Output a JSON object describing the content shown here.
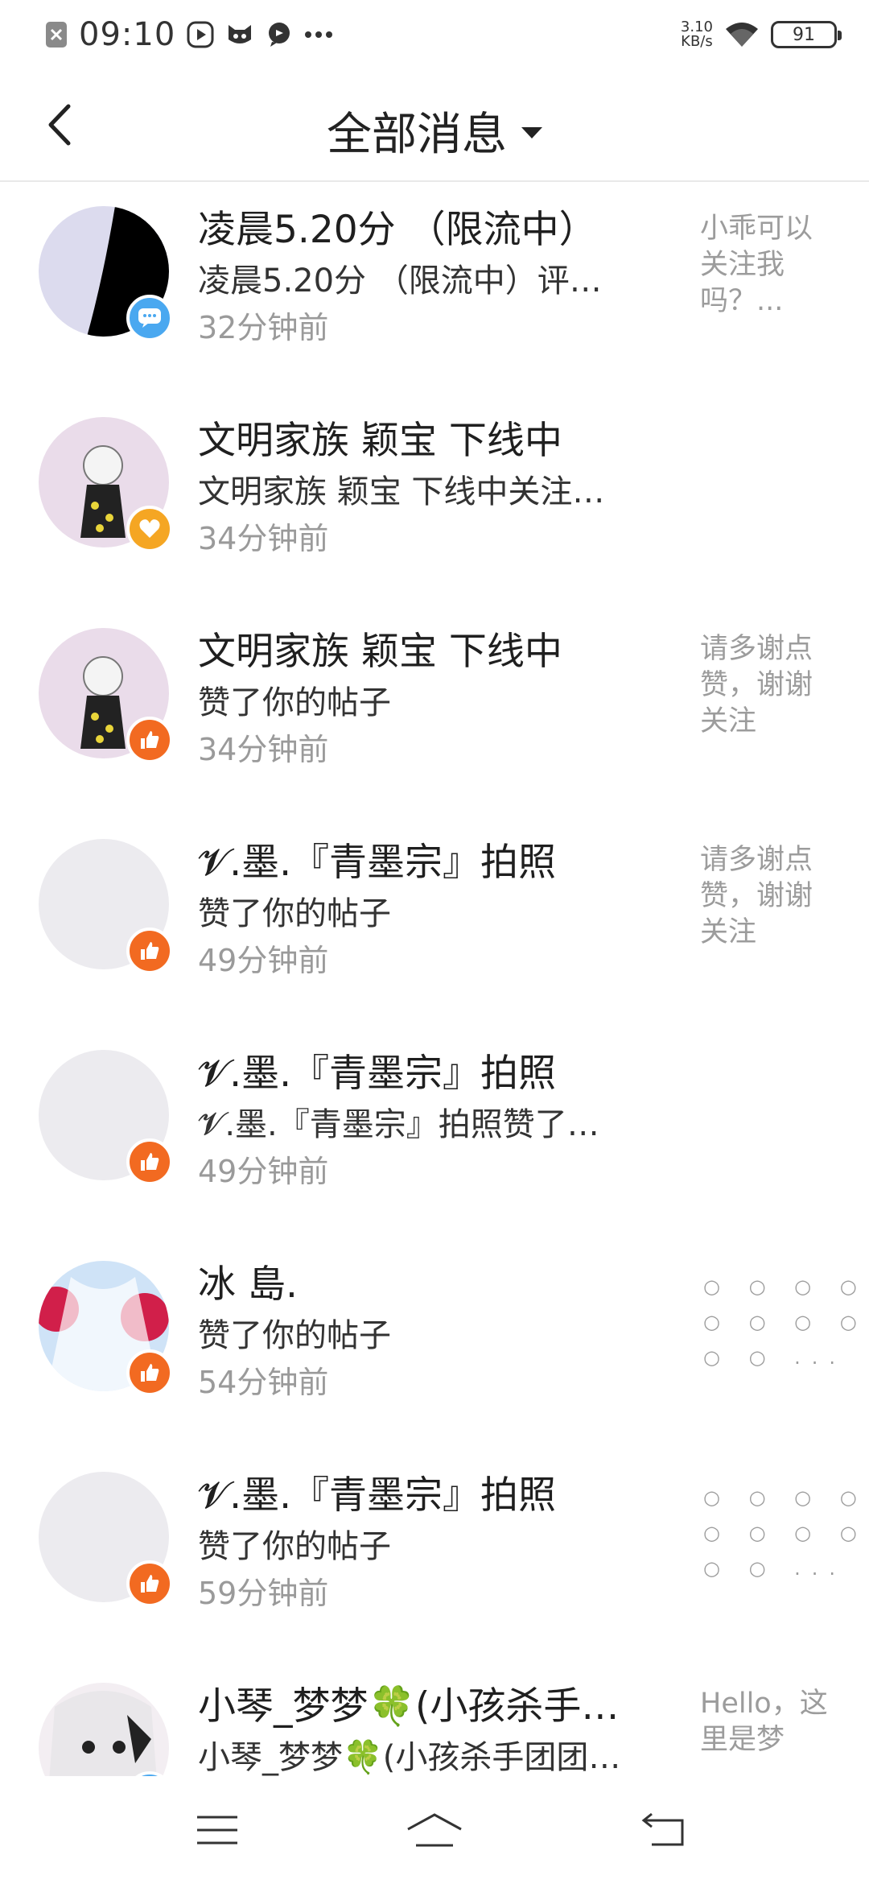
{
  "status_bar": {
    "time": "09:10",
    "net_speed_value": "3.10",
    "net_speed_unit": "KB/s",
    "battery": "91",
    "icons": [
      "close-box-icon",
      "play-circle-icon",
      "cat-app-icon",
      "chat-bubble-icon",
      "more-dots-icon",
      "wifi-icon",
      "battery-icon"
    ]
  },
  "header": {
    "title": "全部消息",
    "back_icon": "chevron-left-icon",
    "dropdown_icon": "caret-down-icon"
  },
  "messages": [
    {
      "name": "凌晨5.20分 （限流中）",
      "content": "凌晨5.20分 （限流中）评…",
      "time": "32分钟前",
      "right_text": "小乖可以关注我吗？...",
      "badge": "msg",
      "avatar_color": "#000000"
    },
    {
      "name": "文明家族  颖宝  下线中",
      "content": "文明家族  颖宝  下线中关注…",
      "time": "34分钟前",
      "right_text": "",
      "badge": "heart",
      "avatar_color": "#eadcea"
    },
    {
      "name": "文明家族  颖宝  下线中",
      "content": "赞了你的帖子",
      "time": "34分钟前",
      "right_text": "请多谢点赞，谢谢关注",
      "badge": "like",
      "avatar_color": "#eadcea"
    },
    {
      "name": "𝓥.墨.『青墨宗』拍照",
      "content": "赞了你的帖子",
      "time": "49分钟前",
      "right_text": "请多谢点赞，谢谢关注",
      "badge": "like",
      "avatar_color": "#ecebef"
    },
    {
      "name": "𝓥.墨.『青墨宗』拍照",
      "content": "𝓥.墨.『青墨宗』拍照赞了…",
      "time": "49分钟前",
      "right_text": "",
      "badge": "like",
      "avatar_color": "#ecebef"
    },
    {
      "name": "冰  島.",
      "content": "赞了你的帖子",
      "time": "54分钟前",
      "right_text": "",
      "dots": "○ ○ ○ ○\n○ ○ ○ ○\n○ ○ ...",
      "badge": "like",
      "avatar_color": "#cfe3f7"
    },
    {
      "name": "𝓥.墨.『青墨宗』拍照",
      "content": "赞了你的帖子",
      "time": "59分钟前",
      "right_text": "",
      "dots": "○ ○ ○ ○\n○ ○ ○ ○\n○ ○ ...",
      "badge": "like",
      "avatar_color": "#ecebef"
    },
    {
      "name": "小琴_梦梦🍀(小孩杀手…",
      "content": "小琴_梦梦🍀(小孩杀手团团…",
      "time": "",
      "right_text": "Hello，这里是梦",
      "badge": "msg",
      "avatar_color": "#f3eef2"
    }
  ],
  "navbar": {
    "icons": [
      "menu-icon",
      "home-icon",
      "back-arrow-icon"
    ]
  }
}
